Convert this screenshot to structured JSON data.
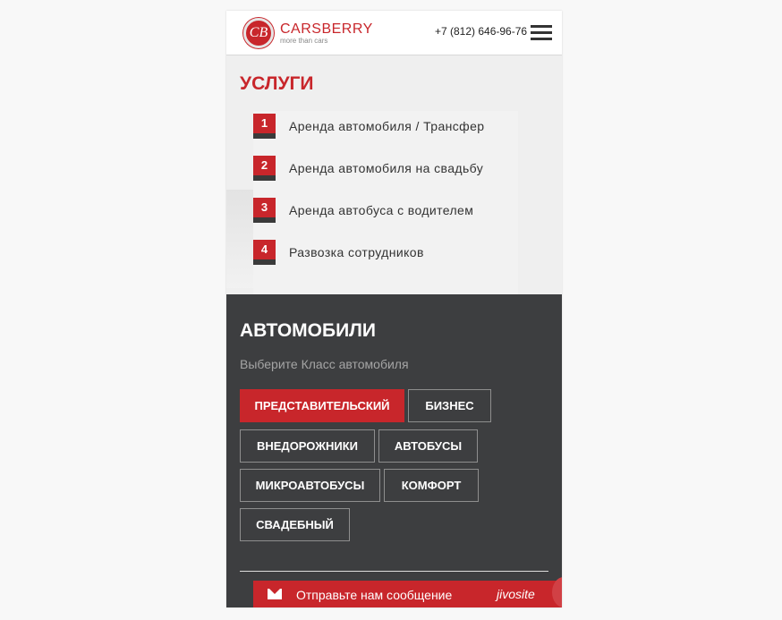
{
  "header": {
    "logo_monogram": "CB",
    "logo_name": "CARSBERRY",
    "logo_tagline": "more than cars",
    "phone": "+7 (812) 646-96-76"
  },
  "services": {
    "title": "УСЛУГИ",
    "items": [
      {
        "num": "1",
        "label": "Аренда автомобиля / Трансфер"
      },
      {
        "num": "2",
        "label": "Аренда автомобиля на свадьбу"
      },
      {
        "num": "3",
        "label": "Аренда автобуса с водителем"
      },
      {
        "num": "4",
        "label": "Развозка сотрудников"
      }
    ]
  },
  "cars": {
    "title": "АВТОМОБИЛИ",
    "subtitle": "Выберите Класс автомобиля",
    "classes": [
      {
        "label": "ПРЕДСТАВИТЕЛЬСКИЙ",
        "active": true
      },
      {
        "label": "БИЗНЕС",
        "active": false
      },
      {
        "label": "ВНЕДОРОЖНИКИ",
        "active": false
      },
      {
        "label": "АВТОБУСЫ",
        "active": false
      },
      {
        "label": "МИКРОАВТОБУСЫ",
        "active": false
      },
      {
        "label": "КОМФОРТ",
        "active": false
      },
      {
        "label": "СВАДЕБНЫЙ",
        "active": false
      }
    ]
  },
  "chat": {
    "label": "Отправьте нам сообщение",
    "brand": "jivosite"
  },
  "colors": {
    "accent": "#c8262b",
    "dark_section": "#3d3e40"
  }
}
